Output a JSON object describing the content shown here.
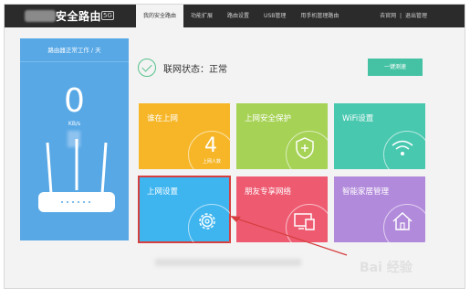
{
  "header": {
    "brand": "安全路由",
    "brand_badge": "5G",
    "nav": [
      "我的安全路由",
      "功能扩展",
      "路由设置",
      "USB管理",
      "用手机管理路由"
    ],
    "right": [
      "去官网",
      "|",
      "退出管理"
    ]
  },
  "left_panel": {
    "status_text": "路由器正常工作 / 天",
    "speed_value": "0",
    "speed_unit": "KB/s"
  },
  "status": {
    "label": "联网状态：正常",
    "detect_button": "一键测速"
  },
  "tiles": [
    {
      "label": "谁在上网",
      "count": "4",
      "count_label": "上网人数",
      "color": "#f6b628"
    },
    {
      "label": "上网安全保护",
      "icon": "shield-icon",
      "color": "#a6d255"
    },
    {
      "label": "WiFi设置",
      "icon": "wifi-icon",
      "color": "#49c8b0"
    },
    {
      "label": "上网设置",
      "icon": "gear-icon",
      "color": "#3fb5ef"
    },
    {
      "label": "朋友专享网络",
      "icon": "devices-icon",
      "color": "#ee5b71"
    },
    {
      "label": "智能家居管理",
      "icon": "home-icon",
      "color": "#b28adb"
    }
  ],
  "watermark": "Bai 经验"
}
